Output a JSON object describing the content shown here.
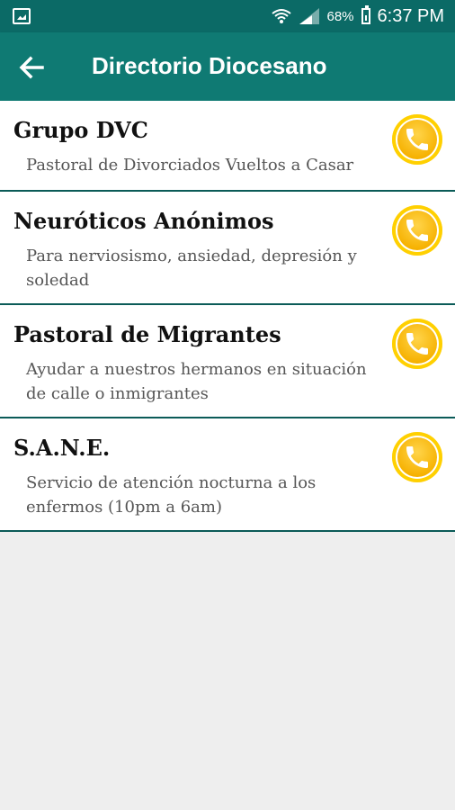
{
  "status": {
    "battery_percent": "68%",
    "time": "6:37 PM"
  },
  "appbar": {
    "title": "Directorio Diocesano"
  },
  "items": [
    {
      "name": "Grupo DVC",
      "desc": "Pastoral de Divorciados Vueltos a Casar"
    },
    {
      "name": "Neuróticos Anónimos",
      "desc": "Para nerviosismo, ansiedad, depresión y soledad"
    },
    {
      "name": "Pastoral de Migrantes",
      "desc": "Ayudar a nuestros hermanos en situación de calle o inmigrantes"
    },
    {
      "name": "S.A.N.E.",
      "desc": "Servicio de atención nocturna a los enfermos (10pm a 6am)"
    }
  ],
  "colors": {
    "statusbar": "#0b6a66",
    "appbar": "#0f7a73",
    "call_button": "#f6b100"
  },
  "icons": {
    "back": "arrow-left-icon",
    "call": "phone-icon",
    "status_left": "image-notification-icon",
    "wifi": "wifi-icon",
    "signal": "cell-signal-icon",
    "battery": "battery-icon"
  }
}
